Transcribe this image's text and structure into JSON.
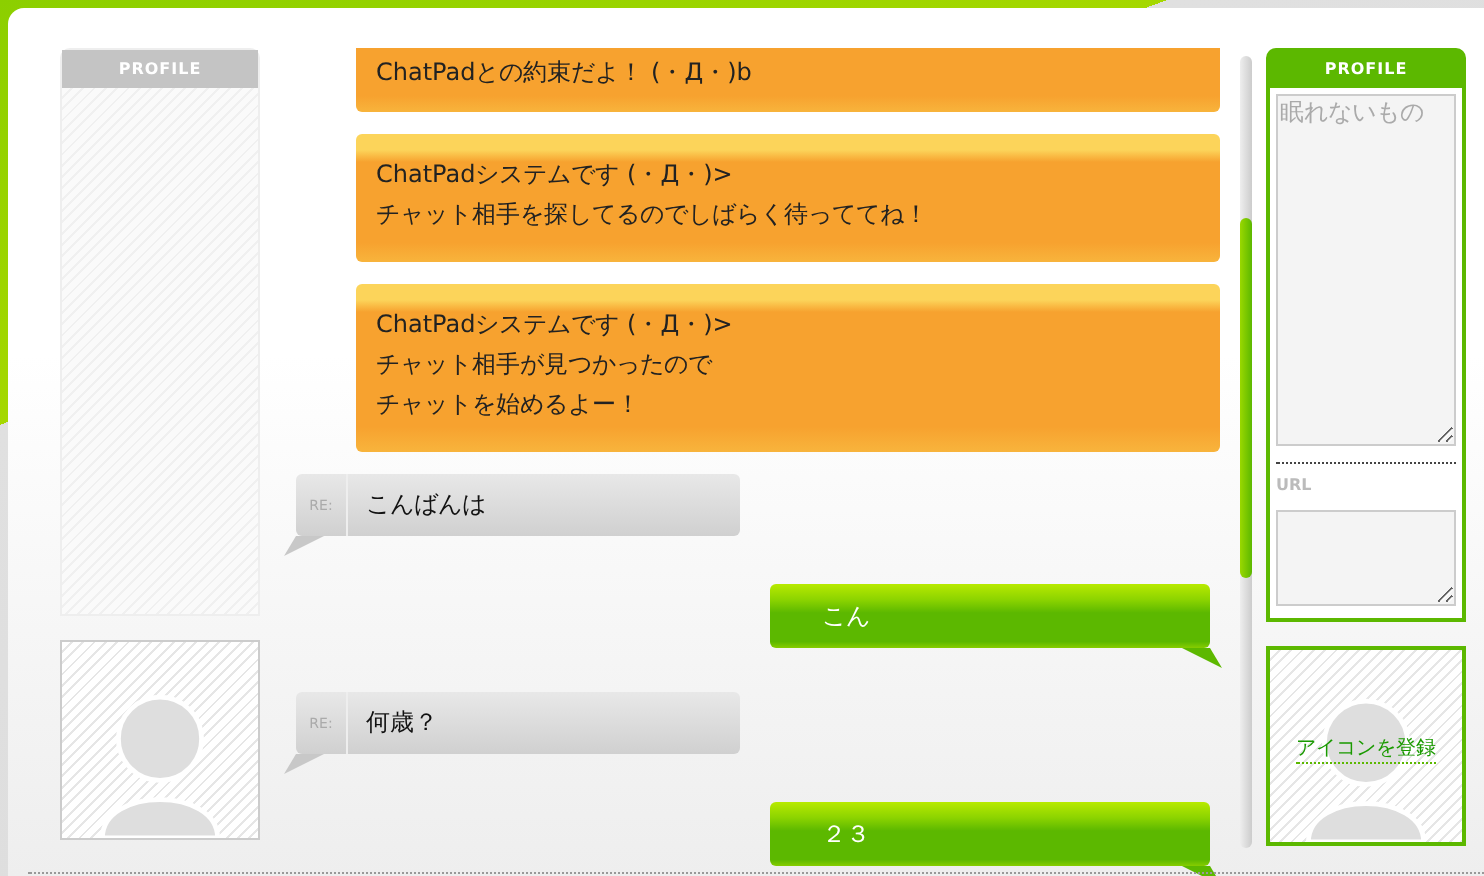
{
  "left_profile": {
    "title": "PROFILE"
  },
  "messages": [
    {
      "kind": "system",
      "lines": [
        "ChatPadとの約束だよ！ (・Д・)b"
      ],
      "cut": true
    },
    {
      "kind": "system",
      "lines": [
        "ChatPadシステムです (・Д・)>",
        "チャット相手を探してるのでしばらく待っててね！"
      ]
    },
    {
      "kind": "system",
      "lines": [
        "ChatPadシステムです (・Д・)>",
        "チャット相手が見つかったので",
        "チャットを始めるよー！"
      ]
    },
    {
      "kind": "received",
      "label": "RE:",
      "lines": [
        "こんばんは"
      ]
    },
    {
      "kind": "sent",
      "lines": [
        "こん"
      ]
    },
    {
      "kind": "received",
      "label": "RE:",
      "lines": [
        "何歳？"
      ]
    },
    {
      "kind": "sent",
      "lines": [
        "２３"
      ]
    }
  ],
  "right_profile": {
    "title": "PROFILE",
    "profile_text": "眠れないもの",
    "url_label": "URL"
  },
  "icon_link": "アイコンを登録"
}
